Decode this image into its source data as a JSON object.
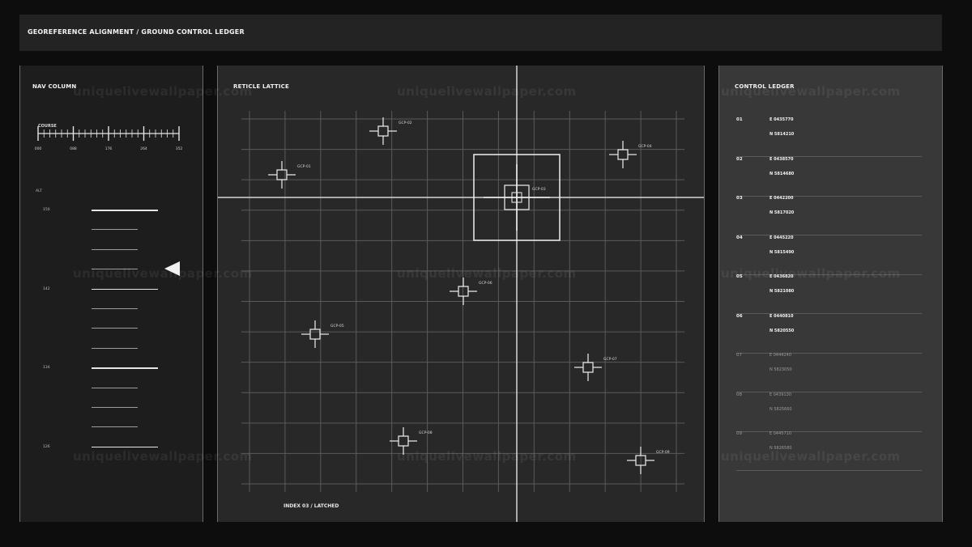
{
  "header": {
    "title": "GEOREFERENCE ALIGNMENT / GROUND CONTROL LEDGER"
  },
  "nav": {
    "title": "NAV COLUMN",
    "course": {
      "label": "COURSE",
      "ticks": [
        "000",
        "088",
        "176",
        "264",
        "352"
      ]
    },
    "alt": {
      "label": "ALT",
      "values": [
        "150",
        "142",
        "134",
        "126"
      ]
    }
  },
  "reticle": {
    "title": "RETICLE LATTICE",
    "status": "INDEX 03 / LATCHED",
    "gcps": [
      {
        "id": "GCP-01"
      },
      {
        "id": "GCP-02"
      },
      {
        "id": "GCP-03"
      },
      {
        "id": "GCP-04"
      },
      {
        "id": "GCP-05"
      },
      {
        "id": "GCP-06"
      },
      {
        "id": "GCP-07"
      },
      {
        "id": "GCP-08"
      },
      {
        "id": "GCP-09"
      }
    ]
  },
  "ledger": {
    "title": "CONTROL LEDGER",
    "rows": [
      {
        "idx": "01",
        "e": "E 0435770",
        "n": "N 5814210",
        "active": true
      },
      {
        "idx": "02",
        "e": "E 0438570",
        "n": "N 5814680",
        "active": true
      },
      {
        "idx": "03",
        "e": "E 0442200",
        "n": "N 5817020",
        "active": true
      },
      {
        "idx": "04",
        "e": "E 0445220",
        "n": "N 5815490",
        "active": true
      },
      {
        "idx": "05",
        "e": "E 0436820",
        "n": "N 5821080",
        "active": true
      },
      {
        "idx": "06",
        "e": "E 0440810",
        "n": "N 5820550",
        "active": true
      },
      {
        "idx": "07",
        "e": "E 0444240",
        "n": "N 5823050",
        "active": false
      },
      {
        "idx": "08",
        "e": "E 0439130",
        "n": "N 5825660",
        "active": false
      },
      {
        "idx": "09",
        "e": "E 0445710",
        "n": "N 5826580",
        "active": false
      }
    ]
  },
  "watermark": "uniquelivewallpaper.com",
  "colors": {
    "background": "#0d0d0d",
    "panel": "#282828",
    "accent": "#f2f2f2"
  }
}
